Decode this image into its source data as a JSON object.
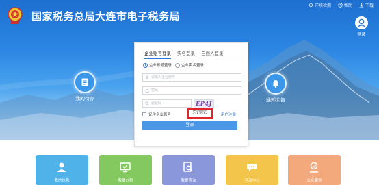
{
  "header": {
    "site_title": "国家税务总局大连市电子税务局",
    "links": [
      {
        "label": "环境检测",
        "icon": "settings-icon"
      },
      {
        "label": "帮助",
        "icon": "help-icon"
      },
      {
        "label": "下载",
        "icon": "download-icon"
      }
    ],
    "login_label": "登录"
  },
  "hero": {
    "left_tile": {
      "label": "我的待办",
      "icon": "todo-icon"
    },
    "right_tile": {
      "label": "通知公告",
      "icon": "bell-icon"
    }
  },
  "login_panel": {
    "tabs": [
      "企业账号登录",
      "实名登录",
      "自然人登录"
    ],
    "active_tab": 0,
    "radio_options": [
      "企业账号登录",
      "企业实名登录"
    ],
    "selected_radio": 0,
    "account_placeholder": "请输入企业账号",
    "password_placeholder": "密码",
    "captcha_placeholder": "验证码",
    "captcha_text": "EP4J",
    "remember_label": "记住企业账号",
    "forgot_label": "忘记密码",
    "register_label": "用户注册",
    "login_button": "登录"
  },
  "services": [
    {
      "label": "我的信息",
      "icon": "user-icon",
      "color": "#4fb3ea"
    },
    {
      "label": "我要办税",
      "icon": "monitor-icon",
      "color": "#84c95f"
    },
    {
      "label": "我要查询",
      "icon": "search-doc-icon",
      "color": "#8a97db"
    },
    {
      "label": "互动中心",
      "icon": "chat-icon",
      "color": "#f3c54a"
    },
    {
      "label": "公众服务",
      "icon": "service-icon",
      "color": "#f3a97c"
    }
  ],
  "colors": {
    "brand_blue": "#2a7be0",
    "highlight_red": "#e0262a"
  }
}
